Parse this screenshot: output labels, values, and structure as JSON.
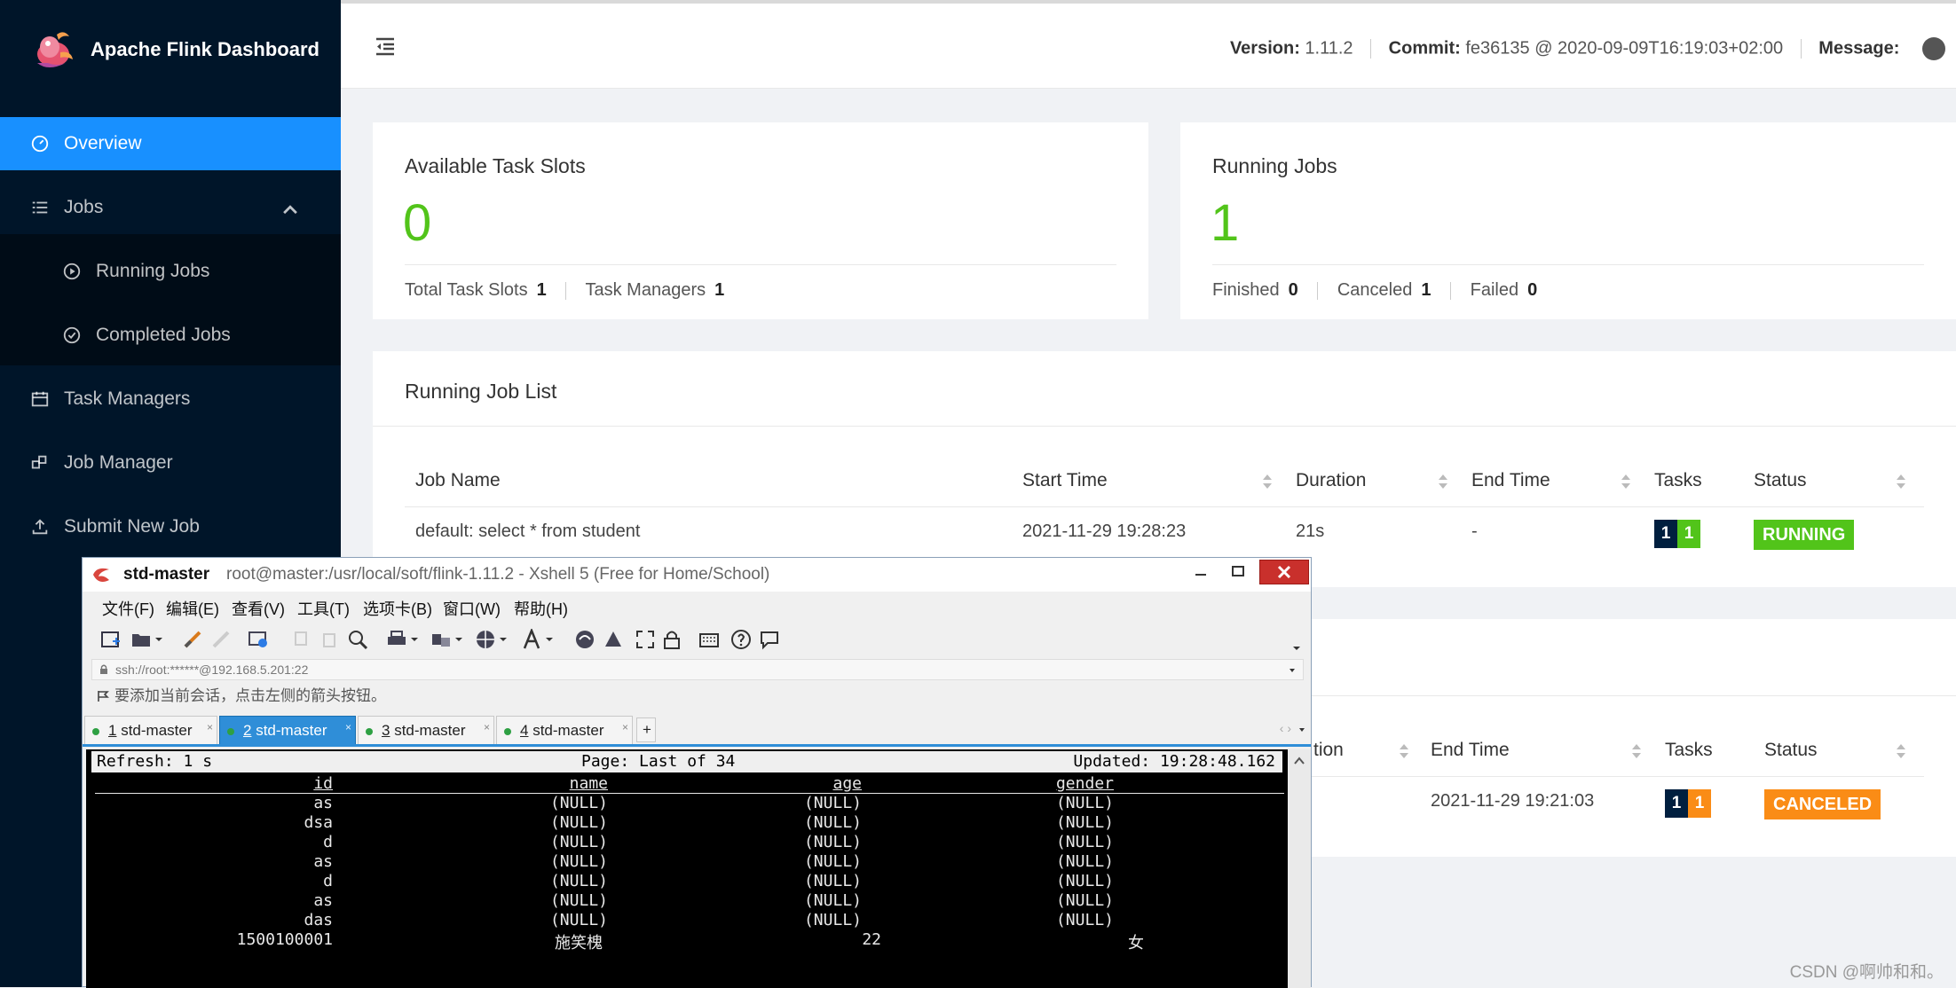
{
  "app": {
    "title": "Apache Flink Dashboard"
  },
  "sidebar": {
    "overview": "Overview",
    "jobs": "Jobs",
    "running_jobs": "Running Jobs",
    "completed_jobs": "Completed Jobs",
    "task_managers": "Task Managers",
    "job_manager": "Job Manager",
    "submit_new_job": "Submit New Job"
  },
  "header": {
    "version_label": "Version:",
    "version_value": "1.11.2",
    "commit_label": "Commit:",
    "commit_value": "fe36135 @ 2020-09-09T16:19:03+02:00",
    "message_label": "Message:"
  },
  "slots_card": {
    "title": "Available Task Slots",
    "value": "0",
    "total_label": "Total Task Slots",
    "total_value": "1",
    "tm_label": "Task Managers",
    "tm_value": "1"
  },
  "jobs_card": {
    "title": "Running Jobs",
    "value": "1",
    "finished_label": "Finished",
    "finished_value": "0",
    "canceled_label": "Canceled",
    "canceled_value": "1",
    "failed_label": "Failed",
    "failed_value": "0"
  },
  "running_list": {
    "title": "Running Job List",
    "columns": {
      "job_name": "Job Name",
      "start_time": "Start Time",
      "duration": "Duration",
      "end_time": "End Time",
      "tasks": "Tasks",
      "status": "Status"
    },
    "row": {
      "job_name": "default: select * from student",
      "start_time": "2021-11-29 19:28:23",
      "duration": "21s",
      "end_time": "-",
      "tasks_a": "1",
      "tasks_b": "1",
      "status": "RUNNING"
    }
  },
  "completed_list": {
    "columns": {
      "duration_partial": "tion",
      "end_time": "End Time",
      "tasks": "Tasks",
      "status": "Status"
    },
    "row": {
      "end_time": "2021-11-29 19:21:03",
      "tasks_a": "1",
      "tasks_b": "1",
      "status": "CANCELED"
    }
  },
  "colors": {
    "sidebar": "#001529",
    "active": "#1890ff",
    "running": "#52c41a",
    "canceled": "#fa8c16",
    "task_dark": "#001f3f"
  },
  "xshell": {
    "title_bold": "std-master",
    "title_path": "root@master:/usr/local/soft/flink-1.11.2 - Xshell 5 (Free for Home/School)",
    "menu": [
      "文件(F)",
      "编辑(E)",
      "查看(V)",
      "工具(T)",
      "选项卡(B)",
      "窗口(W)",
      "帮助(H)"
    ],
    "address": "ssh://root:******@192.168.5.201:22",
    "hint": "要添加当前会话，点击左侧的箭头按钮。",
    "tabs": [
      {
        "num": "1",
        "label": "std-master"
      },
      {
        "num": "2",
        "label": "std-master"
      },
      {
        "num": "3",
        "label": "std-master"
      },
      {
        "num": "4",
        "label": "std-master"
      }
    ],
    "add_tab": "+",
    "terminal": {
      "refresh": "Refresh: 1 s",
      "page": "Page: Last of 34",
      "updated": "Updated: 19:28:48.162",
      "columns": [
        "id",
        "name",
        "age",
        "gender"
      ],
      "rows": [
        [
          "as",
          "(NULL)",
          "(NULL)",
          "(NULL)"
        ],
        [
          "dsa",
          "(NULL)",
          "(NULL)",
          "(NULL)"
        ],
        [
          "d",
          "(NULL)",
          "(NULL)",
          "(NULL)"
        ],
        [
          "as",
          "(NULL)",
          "(NULL)",
          "(NULL)"
        ],
        [
          "d",
          "(NULL)",
          "(NULL)",
          "(NULL)"
        ],
        [
          "as",
          "(NULL)",
          "(NULL)",
          "(NULL)"
        ],
        [
          "das",
          "(NULL)",
          "(NULL)",
          "(NULL)"
        ],
        [
          "1500100001",
          "施笑槐",
          "22",
          "女"
        ]
      ]
    }
  },
  "watermark": "CSDN @啊帅和和。"
}
